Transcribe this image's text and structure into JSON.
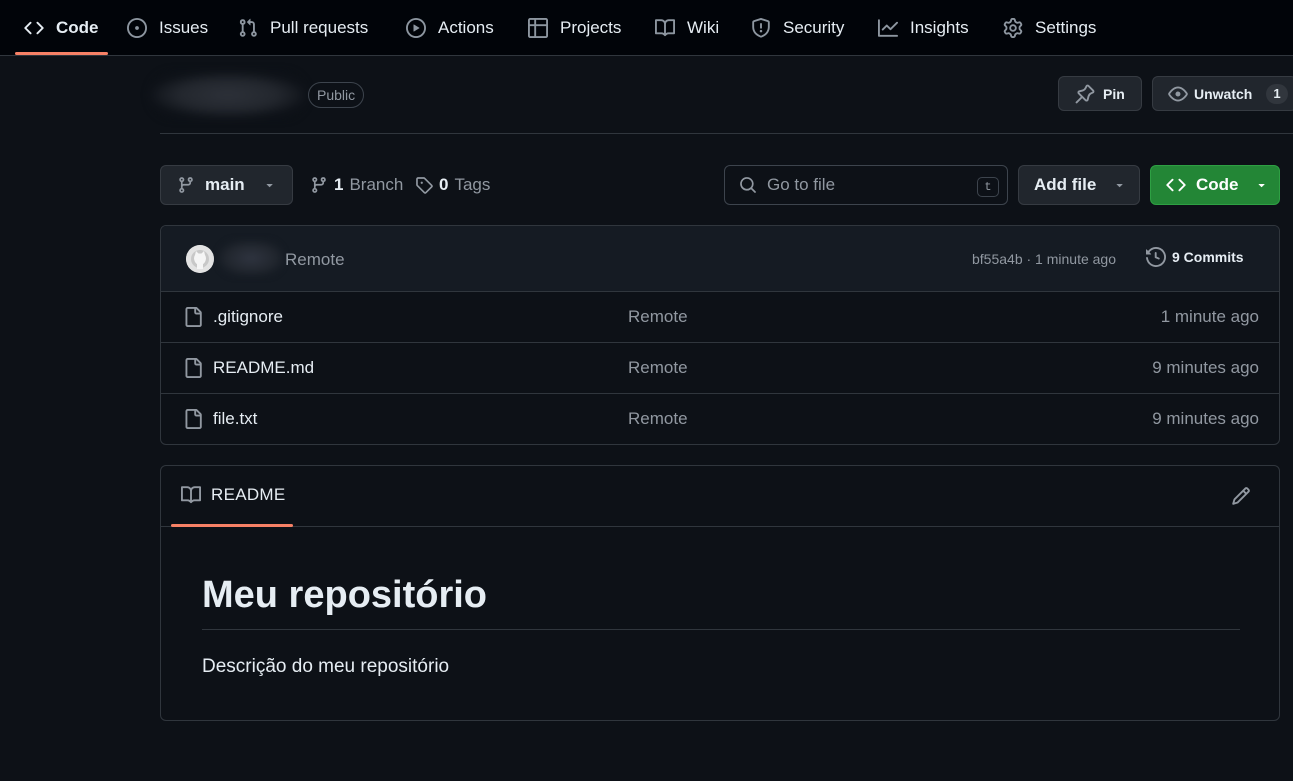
{
  "nav": {
    "tabs": [
      {
        "label": "Code",
        "icon": "code-icon"
      },
      {
        "label": "Issues",
        "icon": "issue-icon"
      },
      {
        "label": "Pull requests",
        "icon": "pull-request-icon"
      },
      {
        "label": "Actions",
        "icon": "play-icon"
      },
      {
        "label": "Projects",
        "icon": "table-icon"
      },
      {
        "label": "Wiki",
        "icon": "book-icon"
      },
      {
        "label": "Security",
        "icon": "shield-icon"
      },
      {
        "label": "Insights",
        "icon": "graph-icon"
      },
      {
        "label": "Settings",
        "icon": "gear-icon"
      }
    ],
    "active": "Code"
  },
  "repo": {
    "visibility": "Public",
    "pin_label": "Pin",
    "unwatch_label": "Unwatch",
    "watchers": "1"
  },
  "toolbar": {
    "branch": "main",
    "branch_count": "1",
    "branch_label": "Branch",
    "tag_count": "0",
    "tag_label": "Tags",
    "search_placeholder": "Go to file",
    "search_shortcut": "t",
    "add_file_label": "Add file",
    "code_label": "Code"
  },
  "latest_commit": {
    "message": "Remote",
    "hash_and_time": "bf55a4b · 1 minute ago",
    "commits_label": "9 Commits"
  },
  "files": [
    {
      "name": ".gitignore",
      "message": "Remote",
      "date": "1 minute ago"
    },
    {
      "name": "README.md",
      "message": "Remote",
      "date": "9 minutes ago"
    },
    {
      "name": "file.txt",
      "message": "Remote",
      "date": "9 minutes ago"
    }
  ],
  "readme": {
    "tab_label": "README",
    "title": "Meu repositório",
    "body": "Descrição do meu repositório"
  },
  "colors": {
    "background": "#0d1117",
    "nav_background": "#010409",
    "accent_underline": "#f78166",
    "code_button": "#238636"
  }
}
